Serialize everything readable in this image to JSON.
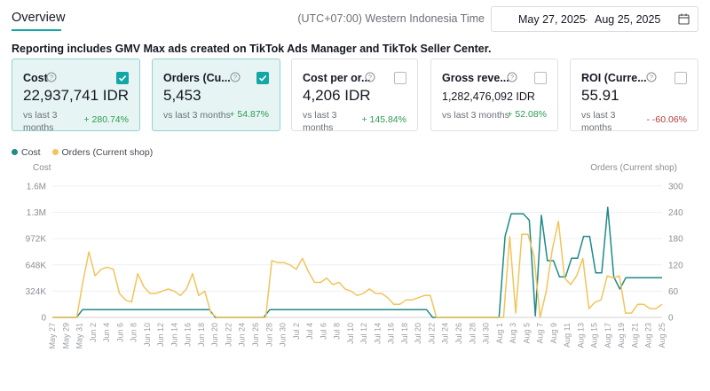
{
  "header": {
    "tab_label": "Overview",
    "timezone": "(UTC+07:00) Western Indonesia Time",
    "date_start": "May 27, 2025",
    "date_separator": "-",
    "date_end": "Aug 25, 2025",
    "calendar_icon": "calendar-icon"
  },
  "note": "Reporting includes GMV Max ads created on TikTok Ads Manager and TikTok Seller Center.",
  "cards": [
    {
      "title": "Cost",
      "value": "22,937,741 IDR",
      "vs": "vs last 3 months",
      "change": "+ 280.74%",
      "direction": "up",
      "checked": true
    },
    {
      "title": "Orders (Cu...",
      "value": "5,453",
      "vs": "vs last 3 months",
      "change": "+ 54.87%",
      "direction": "up",
      "checked": true
    },
    {
      "title": "Cost per or...",
      "value": "4,206 IDR",
      "vs": "vs last 3 months",
      "change": "+ 145.84%",
      "direction": "up",
      "checked": false
    },
    {
      "title": "Gross reve...",
      "value": "1,282,476,092 IDR",
      "vs": "vs last 3 months",
      "change": "+ 52.08%",
      "direction": "up",
      "checked": false
    },
    {
      "title": "ROI (Curre...",
      "value": "55.91",
      "vs": "vs last 3 months",
      "change": "- -60.06%",
      "direction": "down",
      "checked": false
    }
  ],
  "colors": {
    "accent": "#13a6a6",
    "cost": "#1f8a86",
    "orders": "#f2c45a",
    "up": "#2c9a4f",
    "down": "#b33a3a"
  },
  "chart_data": {
    "type": "line",
    "legend": [
      "Cost",
      "Orders (Current shop)"
    ],
    "ylabel_left": "Cost",
    "ylabel_right": "Orders (Current shop)",
    "yticks_left": [
      "0",
      "324K",
      "648K",
      "972K",
      "1.3M",
      "1.6M"
    ],
    "yticks_right": [
      "0",
      "60",
      "120",
      "180",
      "240",
      "300"
    ],
    "ylim_left": [
      0,
      1620000
    ],
    "ylim_right": [
      0,
      300
    ],
    "x_tick_labels": [
      "May 27",
      "May 29",
      "May 31",
      "Jun 2",
      "Jun 4",
      "Jun 6",
      "Jun 8",
      "Jun 10",
      "Jun 12",
      "Jun 14",
      "Jun 16",
      "Jun 18",
      "Jun 20",
      "Jun 22",
      "Jun 24",
      "Jun 26",
      "Jun 28",
      "Jun 30",
      "Jul 2",
      "Jul 4",
      "Jul 6",
      "Jul 8",
      "Jul 10",
      "Jul 12",
      "Jul 14",
      "Jul 16",
      "Jul 18",
      "Jul 20",
      "Jul 22",
      "Jul 24",
      "Jul 26",
      "Jul 28",
      "Jul 30",
      "Aug 1",
      "Aug 3",
      "Aug 5",
      "Aug 7",
      "Aug 9",
      "Aug 11",
      "Aug 13",
      "Aug 15",
      "Aug 17",
      "Aug 19",
      "Aug 21",
      "Aug 23",
      "Aug 25"
    ],
    "grid": true,
    "series": [
      {
        "name": "Cost",
        "axis": "left",
        "values": [
          0,
          0,
          0,
          0,
          0,
          95000,
          95000,
          95000,
          95000,
          95000,
          95000,
          95000,
          95000,
          95000,
          95000,
          95000,
          95000,
          95000,
          95000,
          95000,
          95000,
          95000,
          95000,
          95000,
          95000,
          95000,
          95000,
          0,
          0,
          0,
          0,
          0,
          0,
          0,
          0,
          0,
          95000,
          95000,
          95000,
          95000,
          95000,
          95000,
          95000,
          95000,
          95000,
          95000,
          95000,
          95000,
          95000,
          95000,
          95000,
          95000,
          95000,
          95000,
          95000,
          95000,
          95000,
          95000,
          95000,
          95000,
          95000,
          95000,
          95000,
          0,
          0,
          0,
          0,
          0,
          0,
          0,
          0,
          0,
          0,
          0,
          0,
          1000000,
          1280000,
          1280000,
          1280000,
          1200000,
          20000,
          1260000,
          700000,
          700000,
          500000,
          500000,
          730000,
          730000,
          1000000,
          1000000,
          550000,
          550000,
          1360000,
          500000,
          350000,
          490000,
          490000,
          490000,
          490000,
          490000,
          490000,
          490000
        ]
      },
      {
        "name": "Orders (Current shop)",
        "axis": "right",
        "values": [
          0,
          0,
          0,
          0,
          0,
          80,
          150,
          95,
          110,
          115,
          110,
          55,
          40,
          35,
          100,
          70,
          55,
          55,
          60,
          65,
          60,
          50,
          65,
          100,
          50,
          60,
          10,
          0,
          0,
          0,
          0,
          0,
          0,
          0,
          0,
          0,
          130,
          125,
          125,
          120,
          110,
          135,
          105,
          80,
          80,
          90,
          75,
          80,
          65,
          60,
          50,
          55,
          65,
          55,
          55,
          45,
          30,
          30,
          40,
          40,
          45,
          50,
          50,
          0,
          0,
          0,
          0,
          0,
          0,
          0,
          0,
          0,
          0,
          0,
          0,
          185,
          10,
          190,
          190,
          140,
          0,
          60,
          155,
          220,
          90,
          75,
          95,
          135,
          20,
          35,
          40,
          95,
          90,
          95,
          10,
          10,
          30,
          30,
          20,
          20,
          30
        ]
      }
    ]
  }
}
